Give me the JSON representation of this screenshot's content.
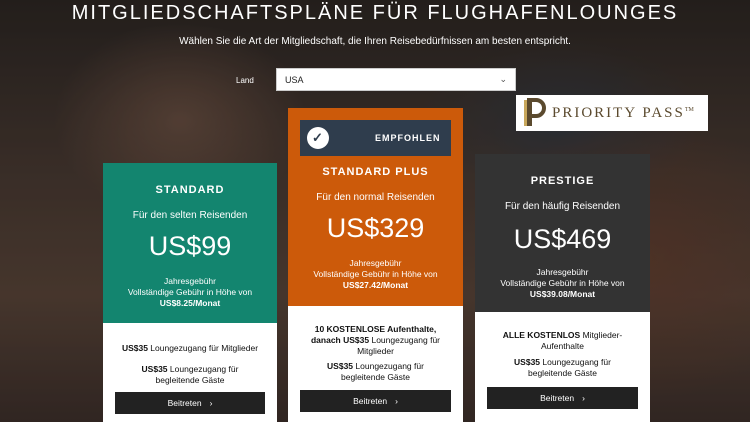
{
  "header": {
    "title": "MITGLIEDSCHAFTSPLÄNE FÜR FLUGHAFENLOUNGES",
    "subtitle": "Wählen Sie die Art der Mitgliedschaft, die Ihren Reisebedürfnissen am besten entspricht."
  },
  "country": {
    "label": "Land",
    "value": "USA"
  },
  "logo": {
    "text": "PRIORITY PASS",
    "tm": "TM"
  },
  "plans": [
    {
      "name": "STANDARD",
      "tagline": "Für den selten Reisenden",
      "price": "US$99",
      "fee_label": "Jahresgebühr",
      "full_fee_prefix": "Vollständige Gebühr in Höhe von",
      "monthly": "US$8.25/Monat",
      "feature1_bold": "US$35",
      "feature1_text": " Loungezugang für Mitglieder",
      "feature2_bold": "US$35",
      "feature2_text": " Loungezugang für begleitende Gäste",
      "button": "Beitreten",
      "color": "#13856f"
    },
    {
      "name": "STANDARD PLUS",
      "tagline": "Für den normal Reisenden",
      "price": "US$329",
      "fee_label": "Jahresgebühr",
      "full_fee_prefix": "Vollständige Gebühr in Höhe von",
      "monthly": "US$27.42/Monat",
      "recommended": "EMPFOHLEN",
      "feature1_bold": "10 KOSTENLOSE Aufenthalte, danach US$35",
      "feature1_text": " Loungezugang für Mitglieder",
      "feature2_bold": "US$35",
      "feature2_text": " Loungezugang für begleitende Gäste",
      "button": "Beitreten",
      "color": "#cc5a0a"
    },
    {
      "name": "PRESTIGE",
      "tagline": "Für den häufig Reisenden",
      "price": "US$469",
      "fee_label": "Jahresgebühr",
      "full_fee_prefix": "Vollständige Gebühr in Höhe von",
      "monthly": "US$39.08/Monat",
      "feature1_bold": "ALLE KOSTENLOS",
      "feature1_text": " Mitglieder-Aufenthalte",
      "feature2_bold": "US$35",
      "feature2_text": " Loungezugang für begleitende Gäste",
      "button": "Beitreten",
      "color": "#333333"
    }
  ],
  "icons": {
    "check": "check-circle-icon",
    "chevron": "chevron-down-icon",
    "arrow": "chevron-right-icon"
  }
}
